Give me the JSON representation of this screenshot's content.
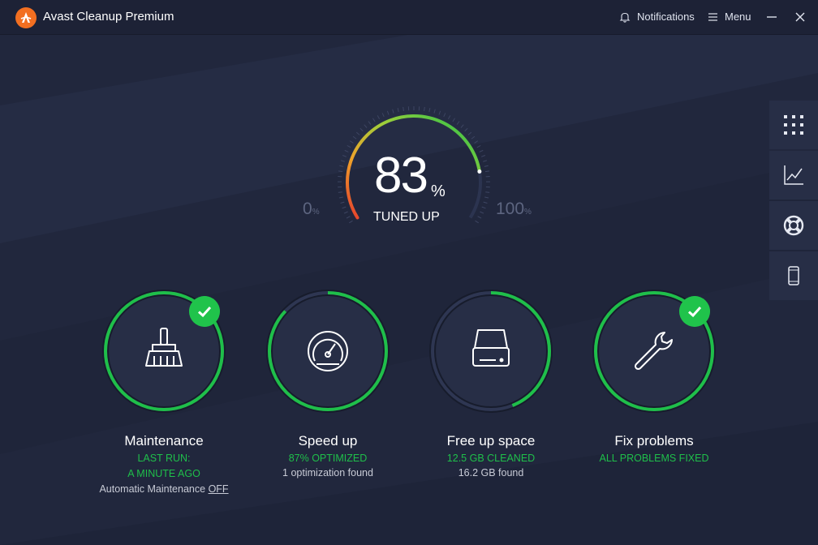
{
  "app": {
    "title": "Avast Cleanup Premium"
  },
  "titlebar": {
    "notifications_label": "Notifications",
    "menu_label": "Menu",
    "minimize_icon": "minimize-icon",
    "close_icon": "close-icon"
  },
  "sidebar": {
    "items": [
      {
        "icon": "grid-icon"
      },
      {
        "icon": "chart-icon"
      },
      {
        "icon": "lifebuoy-icon"
      },
      {
        "icon": "phone-icon"
      }
    ]
  },
  "gauge": {
    "value": "83",
    "unit": "%",
    "label": "TUNED UP",
    "min_value": "0",
    "min_unit": "%",
    "max_value": "100",
    "max_unit": "%",
    "progress": 0.83
  },
  "cards": [
    {
      "title": "Maintenance",
      "line1": "LAST RUN:",
      "line2": "A MINUTE AGO",
      "line3_prefix": "Automatic Maintenance",
      "line3_link": "OFF",
      "icon": "broom-icon",
      "progress": 1.0,
      "checked": true
    },
    {
      "title": "Speed up",
      "line1": "87% OPTIMIZED",
      "line2": "1 optimization found",
      "icon": "speedometer-icon",
      "progress": 0.87,
      "checked": false
    },
    {
      "title": "Free up space",
      "line1": "12.5 GB CLEANED",
      "line2": "16.2 GB found",
      "icon": "hard-drive-icon",
      "progress": 0.44,
      "checked": false
    },
    {
      "title": "Fix problems",
      "line1": "ALL PROBLEMS FIXED",
      "icon": "wrench-icon",
      "progress": 1.0,
      "checked": true
    }
  ],
  "colors": {
    "background": "#21273d",
    "accent_green": "#1fbf4a",
    "titlebar": "#1d2236",
    "brand_orange": "#f26f21"
  }
}
